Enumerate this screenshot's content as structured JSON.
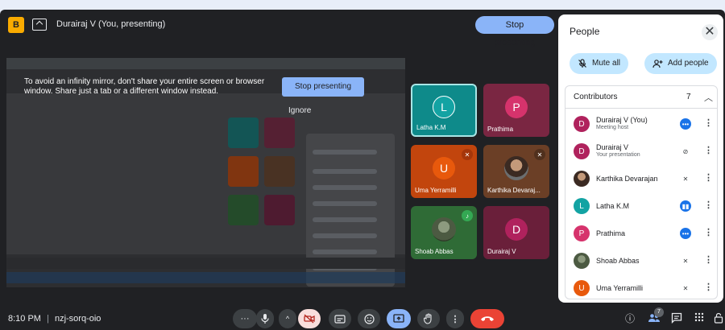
{
  "header": {
    "app_badge": "B",
    "presenting_title": "Durairaj V (You, presenting)",
    "stop_presenting": "Stop presenting"
  },
  "stage": {
    "warning": "To avoid an infinity mirror, don't share your entire screen or browser window. Share just a tab or a different window instead.",
    "stop_presenting": "Stop presenting",
    "ignore": "Ignore"
  },
  "tiles": [
    {
      "name": "Latha K.M",
      "initial": "L",
      "color": "#0e8a8a",
      "avatar_color": "#13a3a3"
    },
    {
      "name": "Prathima",
      "initial": "P",
      "color": "#7a2642",
      "avatar_color": "#d6336c"
    },
    {
      "name": "Uma Yerramilli",
      "initial": "U",
      "color": "#c2450d",
      "avatar_color": "#e8590c"
    },
    {
      "name": "Karthika Devaraj...",
      "initial": "",
      "color": "#6b3f26"
    },
    {
      "name": "Shoab Abbas",
      "initial": "",
      "color": "#2f6b36"
    },
    {
      "name": "Durairaj V",
      "initial": "D",
      "color": "#6a1f3a",
      "avatar_color": "#b0225d"
    }
  ],
  "panel": {
    "title": "People",
    "mute_all": "Mute all",
    "add_people": "Add people",
    "contributors_label": "Contributors",
    "contributors_count": "7",
    "people": [
      {
        "name": "Durairaj V (You)",
        "sub": "Meeting host",
        "initial": "D",
        "color": "#b0225d",
        "status": "speaking"
      },
      {
        "name": "Durairaj V",
        "sub": "Your presentation",
        "initial": "D",
        "color": "#b0225d",
        "status": "muted-presentation"
      },
      {
        "name": "Karthika Devarajan",
        "sub": "",
        "initial": "",
        "color": "#6b3f26",
        "status": "muted"
      },
      {
        "name": "Latha K.M",
        "sub": "",
        "initial": "L",
        "color": "#13a3a3",
        "status": "talking"
      },
      {
        "name": "Prathima",
        "sub": "",
        "initial": "P",
        "color": "#d6336c",
        "status": "speaking"
      },
      {
        "name": "Shoab Abbas",
        "sub": "",
        "initial": "",
        "color": "#4c5a42",
        "status": "muted"
      },
      {
        "name": "Uma Yerramilli",
        "sub": "",
        "initial": "U",
        "color": "#e8590c",
        "status": "muted"
      }
    ]
  },
  "bottom": {
    "time": "8:10 PM",
    "meeting_code": "nzj-sorq-oio",
    "separator": "|",
    "participant_count": "7"
  },
  "colors": {
    "accent": "#8ab4f8",
    "end_call": "#ea4335",
    "panel_pill": "#c2e7ff",
    "background": "#202124"
  }
}
